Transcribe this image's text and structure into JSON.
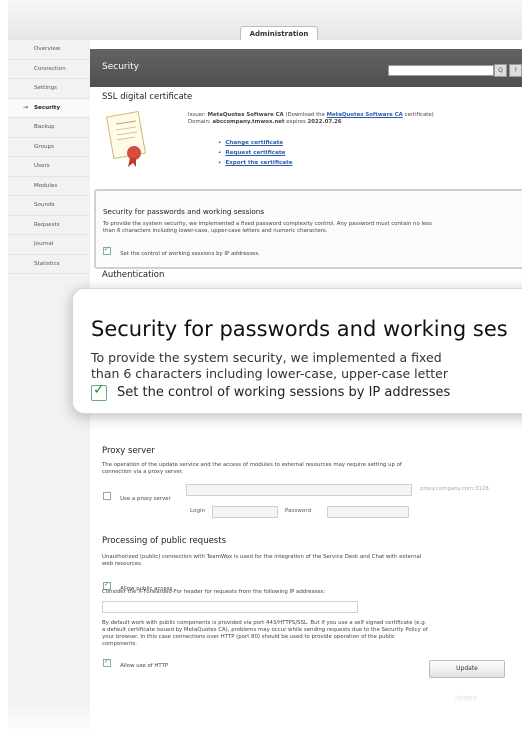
{
  "header_tab": "Administration",
  "nav": [
    "Overview",
    "Connection",
    "Settings",
    "Security",
    "Backup",
    "Groups",
    "Users",
    "Modules",
    "Sounds",
    "Requests",
    "Journal",
    "Statistics"
  ],
  "nav_active_marker": "→",
  "panel": {
    "title": "Security",
    "search_button": "Q",
    "help_button": "?"
  },
  "ssl": {
    "title": "SSL digital certificate",
    "issuer_label": "Issuer:",
    "issuer": "MetaQuotes Software CA",
    "issuer_note_pre": "(Download the",
    "issuer_link": "MetaQuotes Software CA",
    "issuer_note_post": "certificate)",
    "domain_label": "Domain:",
    "domain": "abccompany.tmwox.net",
    "expires_label": "expires",
    "expires": "2022.07.26",
    "links": [
      "Change certificate",
      "Request certificate",
      "Export the certificate"
    ]
  },
  "passwords": {
    "title": "Security for passwords and working sessions",
    "desc_line1": "To provide the system security, we implemented a fixed password complexity control. Any password must contain no less",
    "desc_line2": "than 6 characters including lower-case, upper-case letters and numeric characters.",
    "checkbox": "Set the control of working sessions by IP addresses."
  },
  "authentication_title": "Authentication",
  "zoom": {
    "title": "Security for passwords and working ses",
    "line1": "To provide the system security, we implemented a fixed",
    "line2": "than 6 characters including lower-case, upper-case letter",
    "checkbox": "Set the control of working sessions by IP addresses"
  },
  "proxy": {
    "title": "Proxy server",
    "desc_line1": "The operation of the update service and the access of modules to external resources may require setting up of",
    "desc_line2": "connection via a proxy server.",
    "use_label": "Use a proxy server",
    "placeholder": "proxy.company.com:3128",
    "login_label": "Login",
    "password_label": "Password"
  },
  "public": {
    "title": "Processing of public requests",
    "desc_line1": "Unauthorized (public) connection with TeamWox is used for the integration of the Service Desk and Chat with external",
    "desc_line2": "web resources.",
    "allow_label": "Allow public access",
    "xff_label": "Consider the X-Forwarded-For header for requests from the following IP addresses:",
    "ssl_note1": "By default work with public components is provided via port 443/HTTPS/SSL. But if you use a self signed certificate (e.g.",
    "ssl_note2": "a default certificate issued by MetaQuotes CA), problems may occur while sending requests due to the Security Policy of",
    "ssl_note3": "your browser. In this case connections over HTTP (port 80) should be used to provide operation of the public",
    "ssl_note4": "components.",
    "http_label": "Allow use of HTTP"
  },
  "update_button": "Update",
  "update_reflection": "Update"
}
